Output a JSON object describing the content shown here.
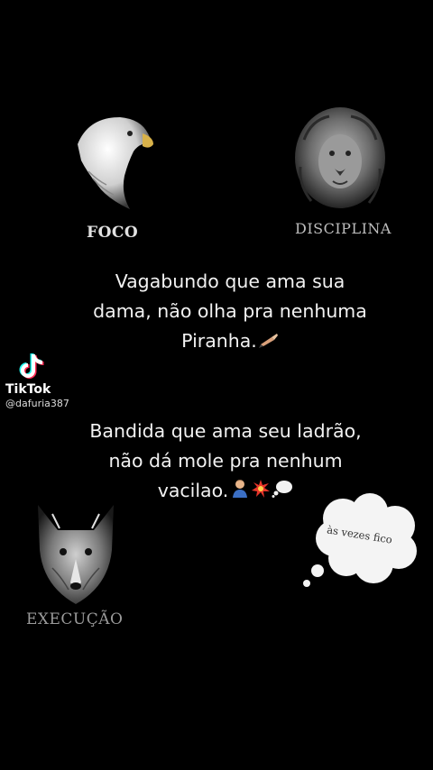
{
  "emblems": {
    "eagle": {
      "caption": "FOCO",
      "icon": "eagle-icon"
    },
    "lion": {
      "caption": "DISCIPLINA",
      "icon": "lion-icon"
    },
    "wolf": {
      "caption": "EXECUÇÃO",
      "icon": "wolf-icon"
    }
  },
  "quote1": {
    "lines": [
      "Vagabundo que ama sua",
      "dama, não olha pra nenhuma",
      "Piranha."
    ],
    "emoji": "writing-hand-icon"
  },
  "quote2": {
    "lines": [
      "Bandida que ama seu ladrão,",
      "não dá mole pra nenhum",
      "vacilao."
    ],
    "emojis": [
      "person-icon",
      "collision-icon",
      "thought-balloon-icon"
    ]
  },
  "watermark": {
    "brand": "TikTok",
    "handle": "@dafuria387"
  },
  "thought_bubble": {
    "text": "às vezes fico"
  }
}
